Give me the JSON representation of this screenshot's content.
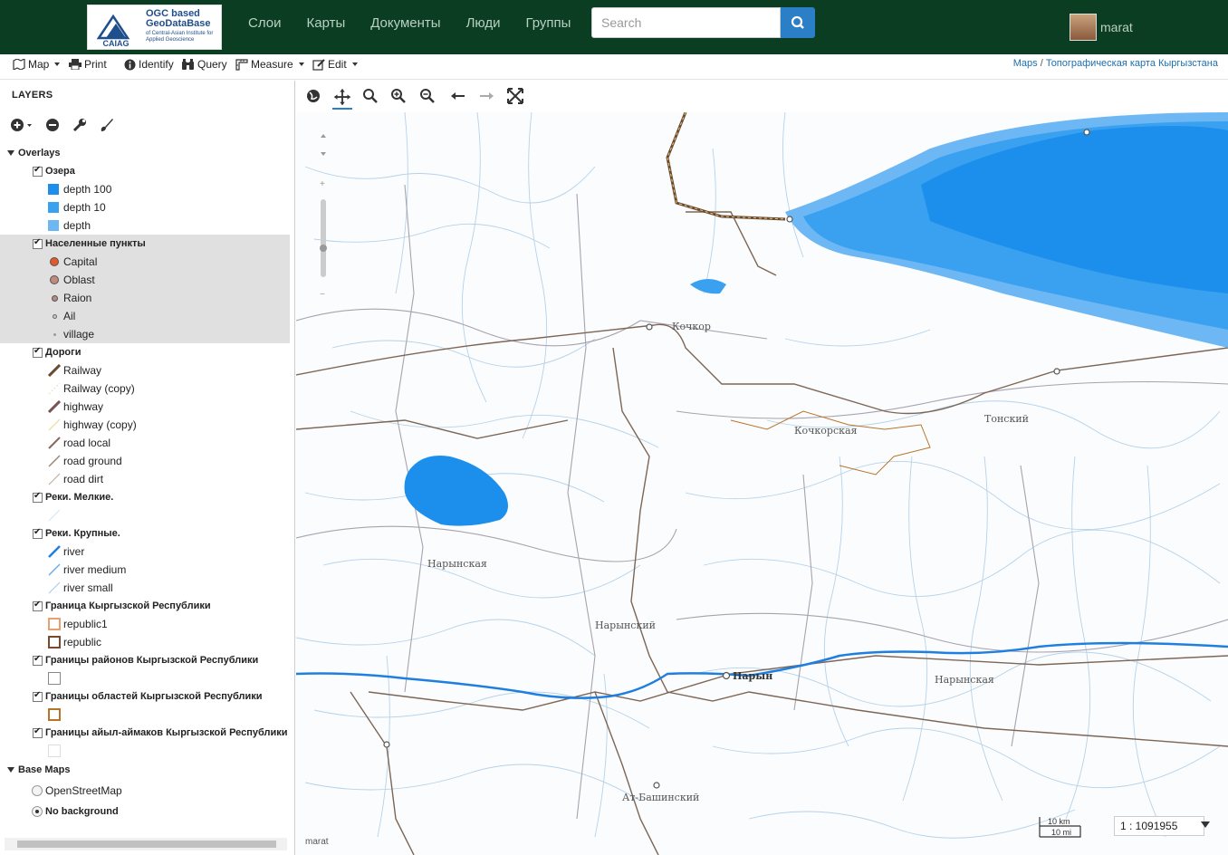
{
  "header": {
    "logo_title": "OGC based GeoDataBase",
    "logo_subtitle": "of Central-Asian Institute for Applied Geoscience",
    "logo_mark": "CAIAG",
    "nav": [
      "Слои",
      "Карты",
      "Документы",
      "Люди",
      "Группы"
    ],
    "search_placeholder": "Search",
    "username": "marat"
  },
  "toolbar": {
    "items": [
      "Map",
      "Print",
      "Identify",
      "Query",
      "Measure",
      "Edit"
    ],
    "breadcrumb_root": "Maps",
    "breadcrumb_sep": "/",
    "breadcrumb_current": "Топографическая карта Кыргызстана"
  },
  "layers": {
    "title": "LAYERS",
    "overlays_label": "Overlays",
    "groups": [
      {
        "name": "Озера",
        "items": [
          "depth 100",
          "depth 10",
          "depth"
        ]
      },
      {
        "name": "Населенные пункты",
        "items": [
          "Capital",
          "Oblast",
          "Raion",
          "Ail",
          "village"
        ]
      },
      {
        "name": "Дороги",
        "items": [
          "Railway",
          "Railway (copy)",
          "highway",
          "highway (copy)",
          "road local",
          "road ground",
          "road dirt"
        ]
      },
      {
        "name": "Реки. Мелкие."
      },
      {
        "name": "Реки. Крупные.",
        "items": [
          "river",
          "river medium",
          "river small"
        ]
      },
      {
        "name": "Граница Кыргызской Республики",
        "items": [
          "republic1",
          "republic"
        ]
      },
      {
        "name": "Границы районов Кыргызской Республики"
      },
      {
        "name": "Границы областей Кыргызской Республики"
      },
      {
        "name": "Границы айыл-аймаков Кыргызской Республики"
      }
    ],
    "base_label": "Base Maps",
    "base_items": [
      "OpenStreetMap",
      "No background"
    ],
    "base_selected": "No background"
  },
  "map": {
    "labels": [
      "Чуйская",
      "Кочкорская",
      "Нарынская",
      "Нарынская",
      "Нарын",
      "Кочкор",
      "Тонский",
      "Кочкор",
      "Нарынский",
      "Ат-Башинский"
    ],
    "attribution": "marat",
    "scale_km": "10 km",
    "scale_mi": "10 mi",
    "scale_ratio": "1 : 1091955"
  },
  "colors": {
    "nav_bg": "#0b3d22",
    "lake_deep": "#1c8fec",
    "lake_mid": "#3aa0f0",
    "lake_shallow": "#6db8f4",
    "river": "#1f7fe0",
    "road": "#7a5c44",
    "highlight": "#e0e0e0"
  }
}
